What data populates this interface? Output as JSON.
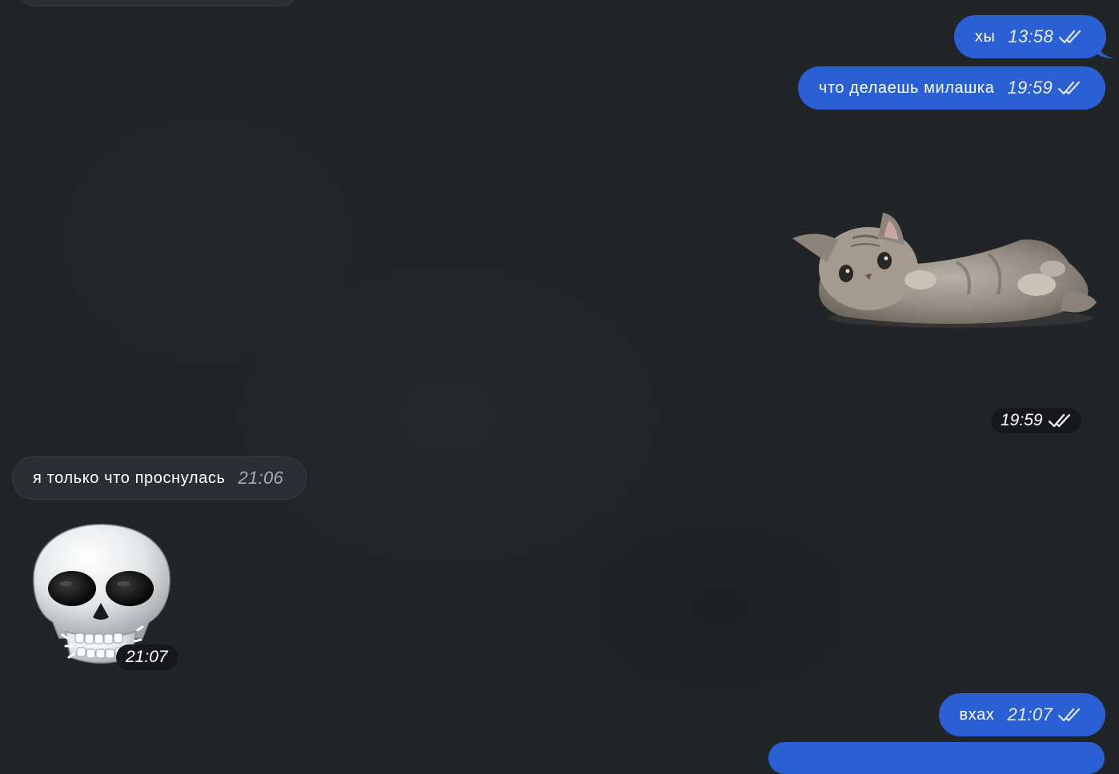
{
  "colors": {
    "background": "#222528",
    "outgoing_bubble": "#2a60d4",
    "incoming_bubble": "#2b2e32",
    "time_chip": "#16181b"
  },
  "messages": [
    {
      "direction": "outgoing",
      "text": "хы",
      "time": "13:58",
      "status_icon": "double-check-icon"
    },
    {
      "direction": "outgoing",
      "text": "что делаешь милашка",
      "time": "19:59",
      "status_icon": "double-check-icon"
    },
    {
      "direction": "outgoing",
      "type": "sticker",
      "sticker_icon": "kitten-sticker-icon",
      "time": "19:59",
      "status_icon": "double-check-icon"
    },
    {
      "direction": "incoming",
      "text": "я только что проснулась",
      "time": "21:06"
    },
    {
      "direction": "incoming",
      "type": "sticker",
      "sticker_icon": "skull-sticker-icon",
      "time": "21:07"
    },
    {
      "direction": "outgoing",
      "text": "вхах",
      "time": "21:07",
      "status_icon": "double-check-icon"
    }
  ]
}
